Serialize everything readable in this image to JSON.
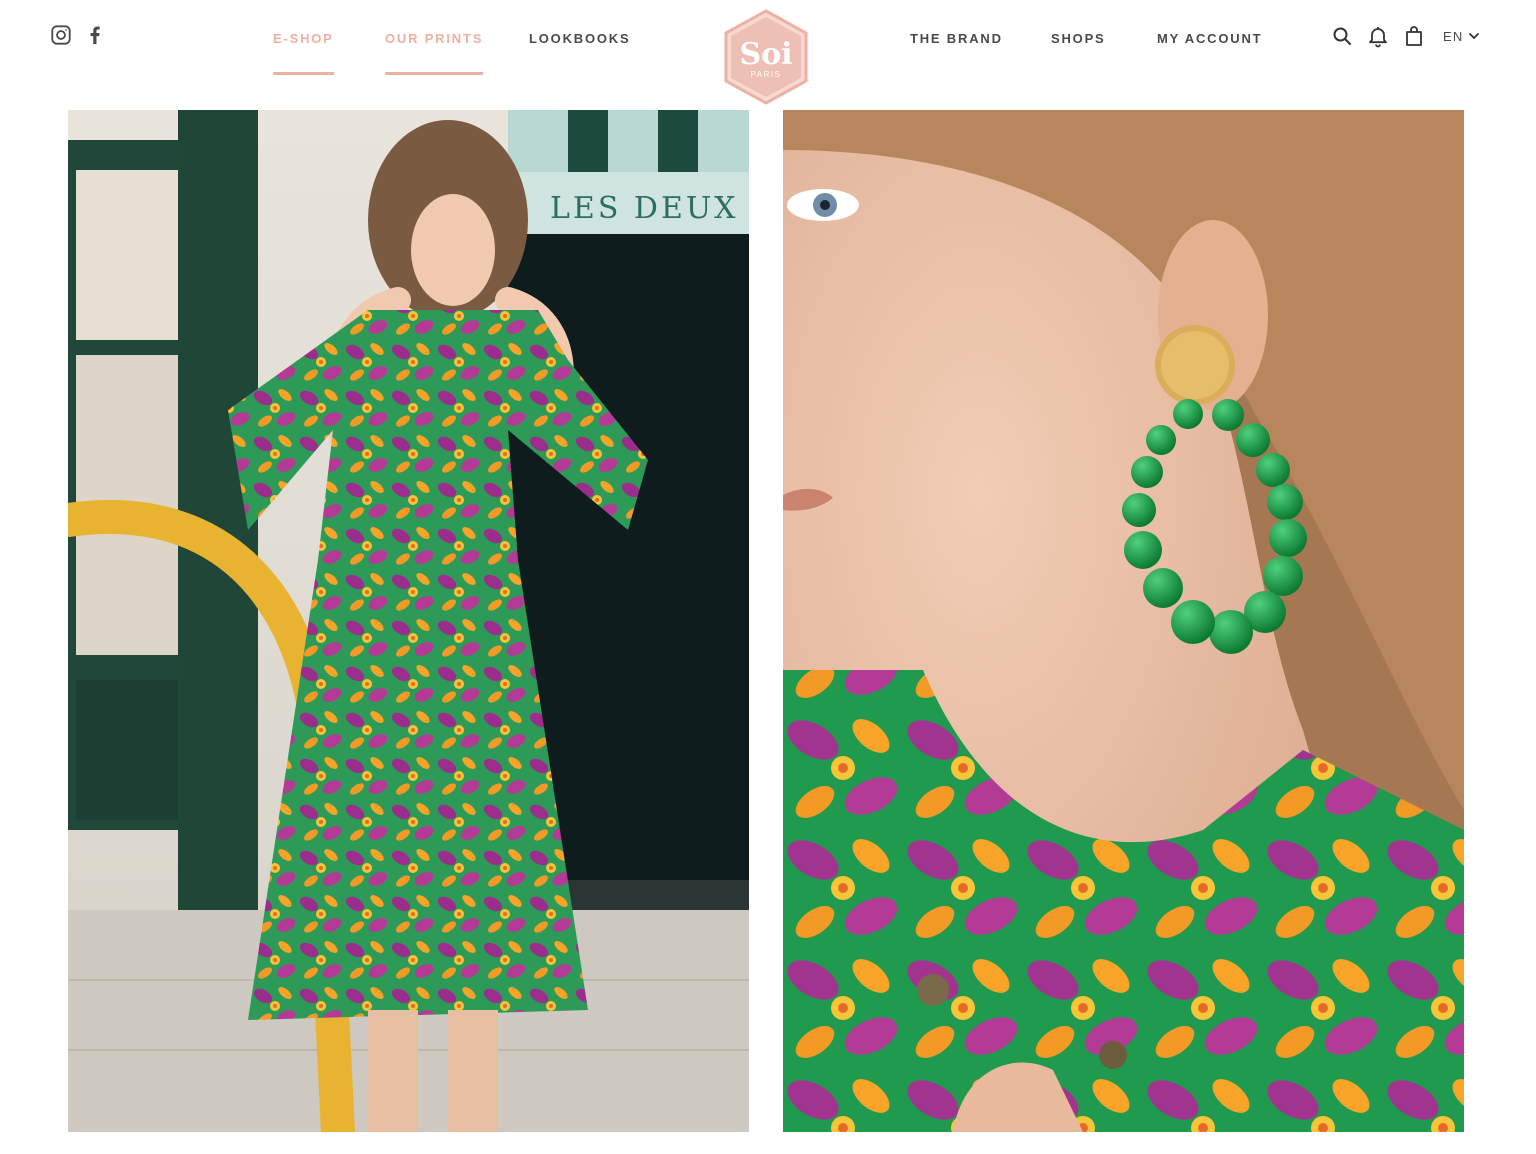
{
  "header": {
    "social": [
      {
        "name": "instagram-icon"
      },
      {
        "name": "facebook-icon"
      }
    ],
    "nav_left": [
      {
        "label": "E-SHOP",
        "active": true
      },
      {
        "label": "OUR PRINTS",
        "active": true
      },
      {
        "label": "LOOKBOOKS",
        "active": false
      }
    ],
    "logo": {
      "brand": "Soi",
      "sub": "PARIS"
    },
    "nav_right": [
      {
        "label": "THE BRAND"
      },
      {
        "label": "SHOPS"
      },
      {
        "label": "MY ACCOUNT"
      }
    ],
    "tools": {
      "icons": [
        "search-icon",
        "bell-icon",
        "shopping-bag-icon"
      ],
      "language": "EN"
    }
  },
  "gallery": {
    "left_sign": "LES DEUX"
  },
  "colors": {
    "accent": "#ecb1a3",
    "text": "#4a4a4a",
    "background": "#ffffff"
  }
}
